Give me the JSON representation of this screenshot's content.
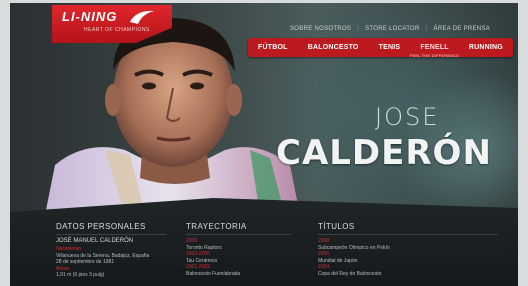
{
  "brand": {
    "logo_text": "LI-NING",
    "logo_sub": "HEART OF CHAMPIONS"
  },
  "top_links": [
    "SOBRE NOSOTROS",
    "STORE LOCATOR",
    "ÁREA DE PRENSA"
  ],
  "nav": [
    {
      "label": "FÚTBOL",
      "sub": ""
    },
    {
      "label": "BALONCESTO",
      "sub": ""
    },
    {
      "label": "TENIS",
      "sub": ""
    },
    {
      "label": "FENELL",
      "sub": "FEEL THE DIFFERENCE"
    },
    {
      "label": "RUNNING",
      "sub": ""
    }
  ],
  "athlete": {
    "first_name": "JOSE",
    "last_name": "CALDERÓN"
  },
  "sections": {
    "personal": {
      "heading": "DATOS PERSONALES",
      "name": "JOSÉ MANUEL CALDERÓN",
      "lines": [
        {
          "text": "Nacimiento",
          "red": true
        },
        {
          "text": "Villanueva de la Serena, Badajoz, España",
          "red": false
        },
        {
          "text": "28 de septiembre de 1981",
          "red": false
        },
        {
          "text": "Altura",
          "red": true
        },
        {
          "text": "1,91 m (6 pies 3 pulg)",
          "red": false
        }
      ]
    },
    "career": {
      "heading": "TRAYECTORIA",
      "lines": [
        {
          "text": "2005",
          "red": true
        },
        {
          "text": "Toronto Raptors",
          "red": false
        },
        {
          "text": "2002-2005",
          "red": true
        },
        {
          "text": "Tau Cerámica",
          "red": false
        },
        {
          "text": "2001-2002",
          "red": true
        },
        {
          "text": "Baloncesto Fuenlabrada",
          "red": false
        }
      ]
    },
    "titles": {
      "heading": "TÍTULOS",
      "lines": [
        {
          "text": "2008",
          "red": true
        },
        {
          "text": "Subcampeón Olímpico en Pekín",
          "red": false
        },
        {
          "text": "2006",
          "red": true
        },
        {
          "text": "Mundial de Japón",
          "red": false
        },
        {
          "text": "2004",
          "red": true
        },
        {
          "text": "Copa del Rey de Baloncesto",
          "red": false
        }
      ]
    }
  },
  "colors": {
    "accent_red": "#bd1a1f",
    "panel_dark": "#1a1f21"
  }
}
